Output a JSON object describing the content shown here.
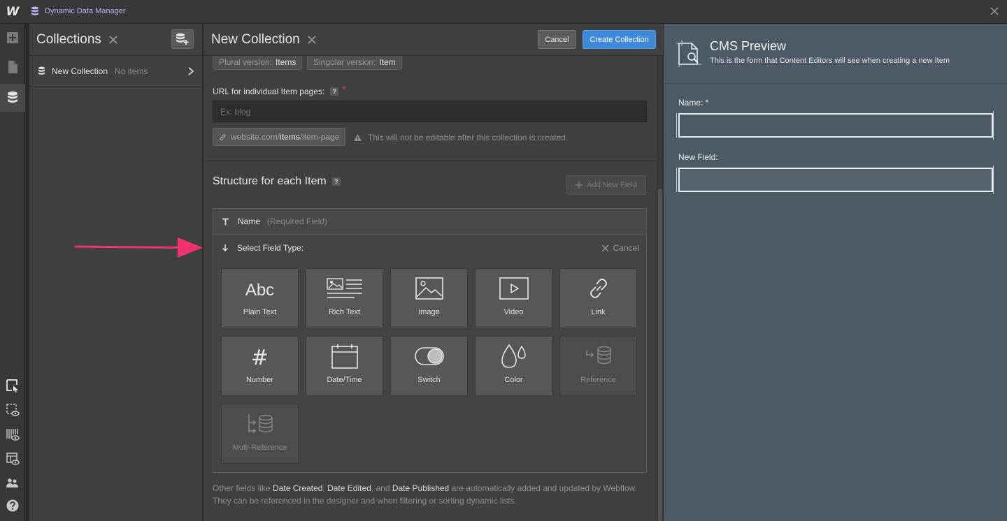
{
  "app": {
    "logo": "W",
    "window_title": "Dynamic Data Manager",
    "accent": "#3f8ad8"
  },
  "collections_panel": {
    "title": "Collections",
    "items": [
      {
        "name": "New Collection",
        "count": "No items"
      }
    ]
  },
  "form": {
    "title": "New Collection",
    "cancel_label": "Cancel",
    "create_label": "Create Collection",
    "plural": {
      "label": "Plural version:",
      "value": "Items"
    },
    "singular": {
      "label": "Singular version:",
      "value": "Item"
    },
    "url_label": "URL for individual Item pages:",
    "url_placeholder": "Ex: blog",
    "url_path": {
      "prefix": "website.com/",
      "bold": "items",
      "suffix": "/item-page"
    },
    "url_warning": "This will not be editable after this collection is created.",
    "structure_title": "Structure for each Item",
    "add_field_label": "Add New Field",
    "name_field": {
      "label": "Name",
      "note": "(Required Field)"
    },
    "select_type_label": "Select Field Type:",
    "select_cancel_label": "Cancel",
    "field_types": [
      {
        "label": "Plain Text",
        "icon": "abc-icon",
        "glyph": "Abc"
      },
      {
        "label": "Rich Text",
        "icon": "rich-text-icon"
      },
      {
        "label": "Image",
        "icon": "image-icon"
      },
      {
        "label": "Video",
        "icon": "video-icon"
      },
      {
        "label": "Link",
        "icon": "link-icon"
      },
      {
        "label": "Number",
        "icon": "hash-icon",
        "glyph": "#"
      },
      {
        "label": "Date/Time",
        "icon": "calendar-icon"
      },
      {
        "label": "Switch",
        "icon": "toggle-icon"
      },
      {
        "label": "Color",
        "icon": "droplets-icon"
      },
      {
        "label": "Reference",
        "icon": "reference-icon"
      },
      {
        "label": "Multi-Reference",
        "icon": "multi-reference-icon"
      }
    ],
    "note": {
      "p1": "Other fields like ",
      "f1": "Date Created",
      "p2": ", ",
      "f2": "Date Edited",
      "p3": ", and ",
      "f3": "Date Published",
      "p4": " are automatically added and updated by Webflow.",
      "line2": "They can be referenced in the designer and when filtering or sorting dynamic lists."
    }
  },
  "preview": {
    "title": "CMS Preview",
    "subtitle": "This is the form that Content Editors will see when creating a new Item",
    "fields": [
      {
        "label": "Name: *"
      },
      {
        "label": "New Field:"
      }
    ]
  },
  "annotation": {
    "arrow_color": "#f0326e"
  }
}
